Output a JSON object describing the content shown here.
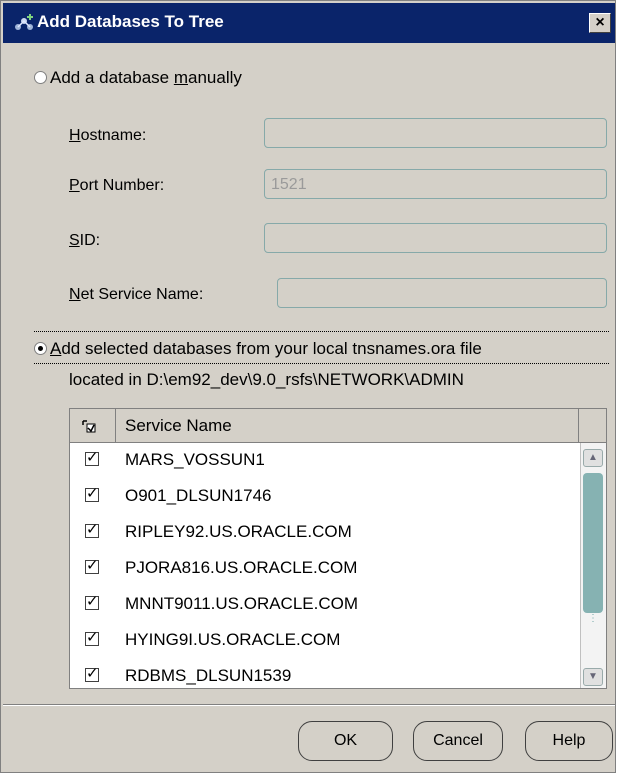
{
  "window": {
    "title": "Add Databases To Tree",
    "close_label": "×"
  },
  "manual": {
    "radio_label_pre": "Add a database ",
    "radio_label_u": "m",
    "radio_label_post": "anually",
    "hostname": {
      "u": "H",
      "rest": "ostname:",
      "value": ""
    },
    "port": {
      "u": "P",
      "rest": "ort Number:",
      "value": "1521"
    },
    "sid": {
      "u": "S",
      "rest": "ID:",
      "value": ""
    },
    "net_service": {
      "u": "N",
      "rest": "et Service Name:",
      "value": ""
    }
  },
  "tns": {
    "radio_label_u": "A",
    "radio_label_rest": "dd selected databases from your local tnsnames.ora file",
    "located": "located in D:\\em92_dev\\9.0_rsfs\\NETWORK\\ADMIN"
  },
  "table": {
    "header": "Service Name",
    "rows": [
      {
        "name": "MARS_VOSSUN1",
        "checked": true
      },
      {
        "name": "O901_DLSUN1746",
        "checked": true
      },
      {
        "name": "RIPLEY92.US.ORACLE.COM",
        "checked": true
      },
      {
        "name": "PJORA816.US.ORACLE.COM",
        "checked": true
      },
      {
        "name": "MNNT9011.US.ORACLE.COM",
        "checked": true
      },
      {
        "name": "HYING9I.US.ORACLE.COM",
        "checked": true
      },
      {
        "name": "RDBMS_DLSUN1539",
        "checked": true
      }
    ]
  },
  "buttons": {
    "ok": "OK",
    "cancel": "Cancel",
    "help": "Help"
  }
}
